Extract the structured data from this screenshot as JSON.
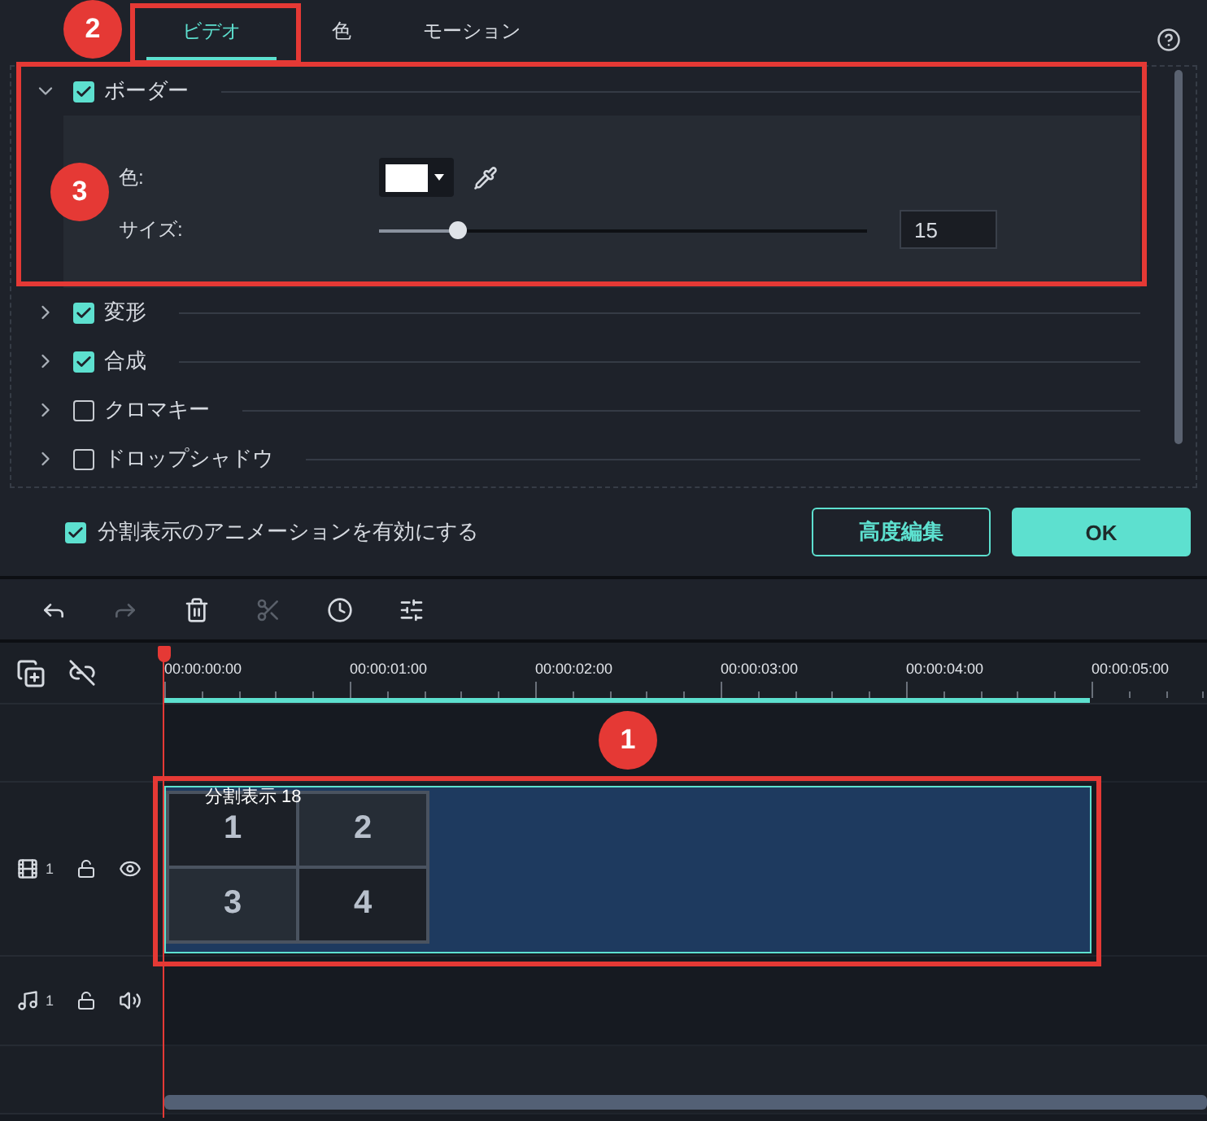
{
  "tabs": [
    {
      "label": "ビデオ",
      "selected": true
    },
    {
      "label": "色",
      "selected": false
    },
    {
      "label": "モーション",
      "selected": false
    }
  ],
  "sections": [
    {
      "label": "ボーダー",
      "checked": true,
      "expanded": true,
      "fields": [
        {
          "kind": "color",
          "label": "色:",
          "color": "#ffffff"
        },
        {
          "kind": "slider",
          "label": "サイズ:",
          "level": 0.16,
          "value": "15"
        }
      ]
    },
    {
      "label": "変形",
      "checked": true,
      "expanded": false
    },
    {
      "label": "合成",
      "checked": true,
      "expanded": false
    },
    {
      "label": "クロマキー",
      "checked": false,
      "expanded": false
    },
    {
      "label": "ドロップシャドウ",
      "checked": false,
      "expanded": false
    }
  ],
  "animation_option": {
    "label": "分割表示のアニメーションを有効にする",
    "checked": true
  },
  "buttons": [
    {
      "label": "高度編集",
      "kind": "outline"
    },
    {
      "label": "OK",
      "kind": "primary"
    }
  ],
  "tools": [
    {
      "kind": "undo",
      "disabled": false
    },
    {
      "kind": "redo",
      "disabled": true
    },
    {
      "kind": "delete",
      "disabled": false
    },
    {
      "kind": "cut",
      "disabled": true
    },
    {
      "kind": "speed",
      "disabled": false
    },
    {
      "kind": "adjust",
      "disabled": false
    }
  ],
  "ruler": [
    "00:00:00:00",
    "00:00:01:00",
    "00:00:02:00",
    "00:00:03:00",
    "00:00:04:00",
    "00:00:05:00"
  ],
  "tracks": [
    {
      "kind": "empty"
    },
    {
      "kind": "video",
      "number": "1",
      "clip": {
        "title": "分割表示 18",
        "cells": [
          "1",
          "2",
          "3",
          "4"
        ]
      }
    },
    {
      "kind": "audio",
      "number": "1"
    },
    {
      "kind": "empty"
    }
  ],
  "annotations": [
    {
      "label": "2"
    },
    {
      "label": "3"
    },
    {
      "label": "1"
    }
  ]
}
